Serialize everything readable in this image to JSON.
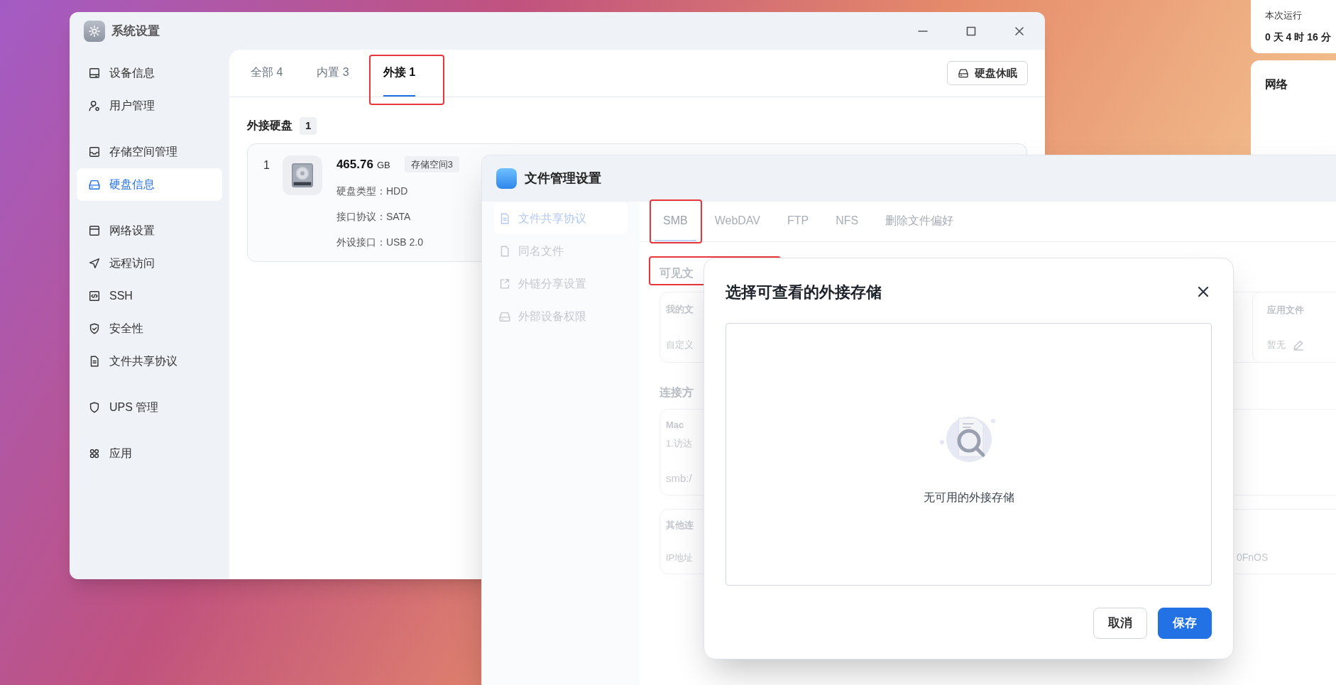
{
  "desktop_widgets": {
    "uptime": {
      "label": "本次运行",
      "value": "0 天 4 时 16 分"
    },
    "network": {
      "title": "网络"
    }
  },
  "system_settings": {
    "title": "系统设置",
    "sidebar": {
      "groups": [
        {
          "items": [
            {
              "label": "设备信息",
              "selected": false
            },
            {
              "label": "用户管理",
              "selected": false
            }
          ]
        },
        {
          "items": [
            {
              "label": "存储空间管理",
              "selected": false
            },
            {
              "label": "硬盘信息",
              "selected": true
            }
          ]
        },
        {
          "items": [
            {
              "label": "网络设置",
              "selected": false
            },
            {
              "label": "远程访问",
              "selected": false
            },
            {
              "label": "SSH",
              "selected": false
            },
            {
              "label": "安全性",
              "selected": false
            },
            {
              "label": "文件共享协议",
              "selected": false
            }
          ]
        },
        {
          "items": [
            {
              "label": "UPS 管理",
              "selected": false
            }
          ]
        },
        {
          "items": [
            {
              "label": "应用",
              "selected": false
            }
          ]
        }
      ]
    },
    "tabs": [
      {
        "label": "全部 4",
        "selected": false
      },
      {
        "label": "内置 3",
        "selected": false
      },
      {
        "label": "外接 1",
        "selected": true
      }
    ],
    "hibernate_button": "硬盘休眠",
    "section": {
      "title": "外接硬盘",
      "count": "1"
    },
    "disks": [
      {
        "index": "1",
        "size": "465.76",
        "unit": "GB",
        "pool": "存储空间3",
        "details": [
          "硬盘类型：HDD",
          "接口协议：SATA",
          "外设接口：USB 2.0"
        ]
      }
    ]
  },
  "file_manager": {
    "title": "文件管理设置",
    "sidebar": [
      {
        "label": "文件共享协议",
        "selected": true
      },
      {
        "label": "同名文件",
        "selected": false
      },
      {
        "label": "外链分享设置",
        "selected": false
      },
      {
        "label": "外部设备权限",
        "selected": false
      }
    ],
    "tabs": [
      {
        "label": "SMB",
        "selected": true
      },
      {
        "label": "WebDAV",
        "selected": false
      },
      {
        "label": "FTP",
        "selected": false
      },
      {
        "label": "NFS",
        "selected": false
      },
      {
        "label": "删除文件偏好",
        "selected": false
      }
    ],
    "visible_heading": "可见文",
    "folder_table": {
      "header": "我的文",
      "row": "自定义"
    },
    "app_files": {
      "header": "应用文件",
      "value": "暂无"
    },
    "connection_heading": "连接方",
    "mac_card": {
      "title": "Mac",
      "step": "1.访达",
      "address": "smb:/"
    },
    "other_card": {
      "title": "其他连",
      "ip_label": "IP地址",
      "value_tail": "0FnOS"
    }
  },
  "dialog": {
    "title": "选择可查看的外接存储",
    "empty_text": "无可用的外接存储",
    "buttons": [
      {
        "label": "取消",
        "kind": "secondary"
      },
      {
        "label": "保存",
        "kind": "primary"
      }
    ]
  }
}
